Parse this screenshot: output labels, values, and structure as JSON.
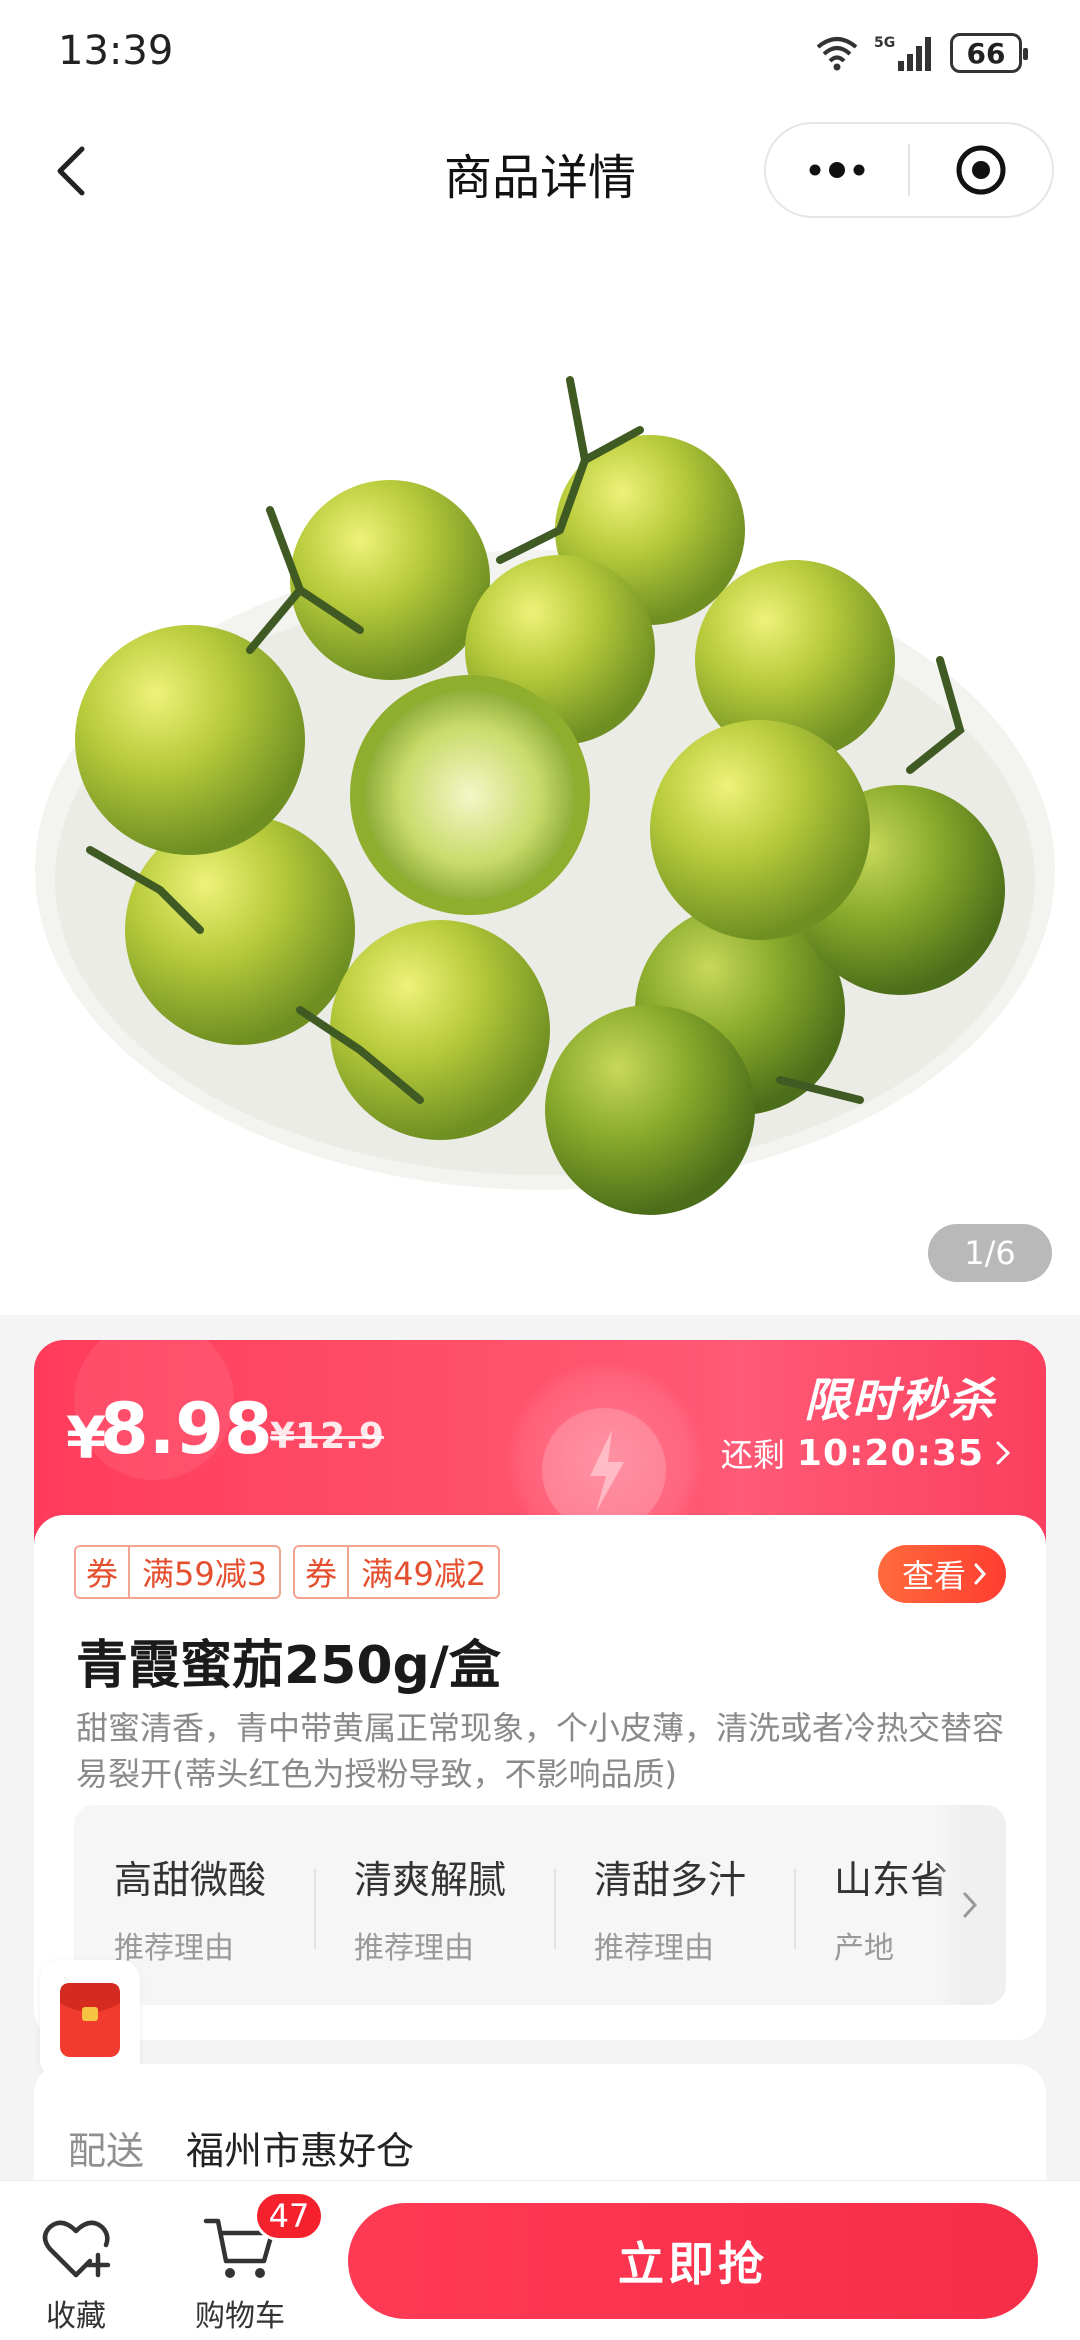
{
  "status_bar": {
    "time": "13:39",
    "network": "5G",
    "battery": "66"
  },
  "nav": {
    "title": "商品详情"
  },
  "product_image": {
    "counter": "1/6"
  },
  "sale": {
    "currency": "¥",
    "price": "8.98",
    "original_price": "¥12.9",
    "title": "限时秒杀",
    "countdown_prefix": "还剩",
    "countdown": "10:20:35"
  },
  "coupons": [
    {
      "tag": "券",
      "amount": "满59减3"
    },
    {
      "tag": "券",
      "amount": "满49减2"
    }
  ],
  "view_button": "查看",
  "product": {
    "title": "青霞蜜茄250g/盒",
    "description": "甜蜜清香，青中带黄属正常现象，个小皮薄，清洗或者冷热交替容易裂开(蒂头红色为授粉导致，不影响品质)"
  },
  "features": [
    {
      "main": "高甜微酸",
      "sub": "推荐理由"
    },
    {
      "main": "清爽解腻",
      "sub": "推荐理由"
    },
    {
      "main": "清甜多汁",
      "sub": "推荐理由"
    },
    {
      "main": "山东省",
      "sub": "产地"
    }
  ],
  "delivery": {
    "label": "配送",
    "value": "福州市惠好仓"
  },
  "bottom_bar": {
    "favorite_label": "收藏",
    "cart_label": "购物车",
    "cart_count": "47",
    "buy_label": "立即抢"
  },
  "colors": {
    "accent": "#ff3b5c",
    "coupon": "#e44f2f"
  }
}
